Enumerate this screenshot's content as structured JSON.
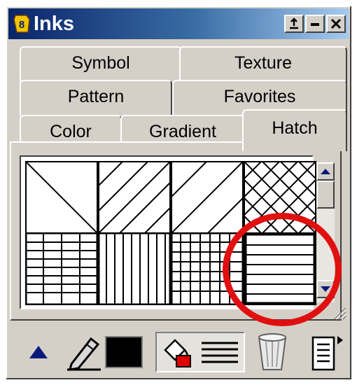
{
  "window": {
    "title": "Inks",
    "controls": [
      "restore",
      "minimize",
      "close"
    ]
  },
  "tabs": {
    "row1": [
      "Symbol",
      "Texture"
    ],
    "row2": [
      "Pattern",
      "Favorites"
    ],
    "row3": [
      "Color",
      "Gradient",
      "Hatch"
    ],
    "active": "Hatch"
  },
  "hatch_patterns": [
    {
      "name": "diagonal-single",
      "row": 1,
      "col": 1
    },
    {
      "name": "diagonal-forward-wide",
      "row": 1,
      "col": 2
    },
    {
      "name": "diagonal-forward-narrow",
      "row": 1,
      "col": 3
    },
    {
      "name": "crosshatch-diagonal",
      "row": 1,
      "col": 4
    },
    {
      "name": "grid-horizontal-heavy",
      "row": 2,
      "col": 1
    },
    {
      "name": "vertical-lines",
      "row": 2,
      "col": 2
    },
    {
      "name": "grid-fine",
      "row": 2,
      "col": 3
    },
    {
      "name": "horizontal-lines",
      "row": 2,
      "col": 4,
      "selected": true
    }
  ],
  "toolbar": {
    "icons": [
      "up-arrow-icon",
      "pen-icon",
      "fill-bucket-icon",
      "wastebasket-icon",
      "panel-menu-icon"
    ],
    "pen_color": "#000000",
    "fill_pattern": "horizontal-lines"
  },
  "colors": {
    "title_start": "#0a246a",
    "title_end": "#a6caf0",
    "highlight": "#e01010",
    "arrow": "#0a1a7a"
  }
}
